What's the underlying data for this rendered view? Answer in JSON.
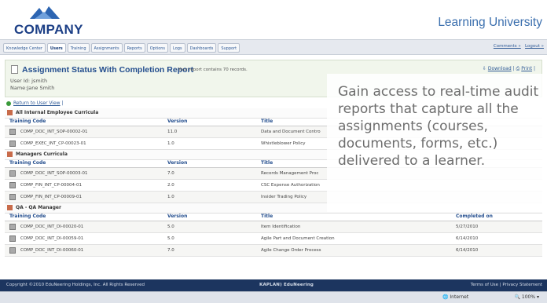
{
  "header": {
    "logo_text": "COMPANY",
    "site_title": "Learning University"
  },
  "nav": {
    "tabs": [
      "Knowledge Center",
      "Users",
      "Training",
      "Assignments",
      "Reports",
      "Options",
      "Logs",
      "Dashboards",
      "Support"
    ],
    "active_tab": "Users",
    "links": {
      "comments": "Comments »",
      "logout": "Logout »"
    }
  },
  "report": {
    "title": "Assignment Status With Completion Report",
    "count_text": "- Your report contains 70 records.",
    "user_id": "User Id: jsmith",
    "user_name": "Name:Jane Smith",
    "download": "Download",
    "print": "Print",
    "return_link": "Return to User View"
  },
  "sections": [
    {
      "title": "All Internal Employee Curricula",
      "headers": [
        "Training Code",
        "Version",
        "Title",
        ""
      ],
      "rows": [
        [
          "COMP_DOC_INT_SOP-00002-01",
          "11.0",
          "Data and Document Contro",
          ""
        ],
        [
          "COMP_EXEC_INT_CP-00023-01",
          "1.0",
          "Whistleblower Policy",
          ""
        ]
      ]
    },
    {
      "title": "Managers Curricula",
      "headers": [
        "Training Code",
        "Version",
        "Title",
        ""
      ],
      "rows": [
        [
          "COMP_DOC_INT_SOP-00003-01",
          "7.0",
          "Records Management Proc",
          ""
        ],
        [
          "COMP_FIN_INT_CP-00004-01",
          "2.0",
          "CSC Expense Authorization",
          ""
        ],
        [
          "COMP_FIN_INT_CP-00009-01",
          "1.0",
          "Insider Trading Policy",
          ""
        ]
      ]
    },
    {
      "title": "QA - QA Manager",
      "headers": [
        "Training Code",
        "Version",
        "Title",
        "Completed on"
      ],
      "rows": [
        [
          "COMP_DOC_INT_DI-00020-01",
          "5.0",
          "Item Identification",
          "5/27/2010"
        ],
        [
          "COMP_DOC_INT_DI-00059-01",
          "5.0",
          "Agile Part and Document Creation",
          "6/14/2010"
        ],
        [
          "COMP_DOC_INT_DI-00060-01",
          "7.0",
          "Agile Change Order Process",
          "6/14/2010"
        ]
      ]
    }
  ],
  "footer": {
    "copyright": "Copyright ©2010 EduNeering Holdings, Inc. All Rights Reserved",
    "brand": "KAPLAN) EduNeering",
    "links": "Terms of Use | Privacy Statement"
  },
  "statusbar": {
    "internet": "Internet",
    "zoom": "100%"
  },
  "overlay": {
    "text": "Gain access to real-time audit reports that capture all the assignments (courses, documents, forms, etc.) delivered to a learner."
  },
  "colors": {
    "brand_blue": "#1c3f86",
    "footer": "#1c355f",
    "header_bg": "#f1f6ec"
  }
}
